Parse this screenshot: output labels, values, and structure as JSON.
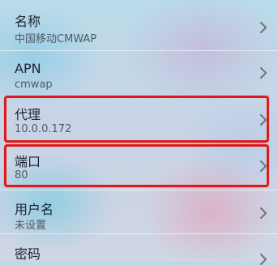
{
  "settings": {
    "items": [
      {
        "label": "名称",
        "value": "中国移动CMWAP"
      },
      {
        "label": "APN",
        "value": "cmwap"
      },
      {
        "label": "代理",
        "value": "10.0.0.172",
        "highlighted": true
      },
      {
        "label": "端口",
        "value": "80",
        "highlighted": true
      },
      {
        "label": "用户名",
        "value": "未设置"
      },
      {
        "label": "密码",
        "value": ""
      }
    ]
  },
  "colors": {
    "highlight": "#e01818",
    "chevron": "#6d7580"
  },
  "icons": {
    "chevron": "chevron-right-icon"
  }
}
